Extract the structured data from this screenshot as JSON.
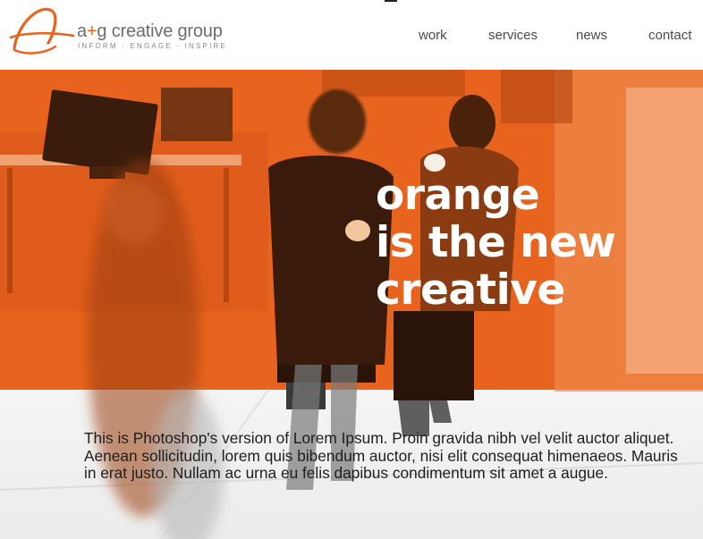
{
  "brand": {
    "name_prefix": "a",
    "name_plus": "+",
    "name_suffix": "g creative group",
    "tagline": "INFORM · ENGAGE · INSPIRE",
    "accent_color": "#e8641e"
  },
  "nav": {
    "items": [
      {
        "label": "work"
      },
      {
        "label": "services"
      },
      {
        "label": "news"
      },
      {
        "label": "contact"
      }
    ]
  },
  "hero": {
    "headline": [
      "orange",
      "is the new",
      "creative"
    ],
    "overlay_color": "#e8641e"
  },
  "body": {
    "text": "This is Photoshop's version  of Lorem Ipsum. Proin gravida nibh vel velit auctor aliquet. Aenean sollicitudin, lorem quis bibendum auctor, nisi elit consequat himenaeos. Mauris in erat justo. Nullam ac urna eu felis dapibus condimentum sit amet a augue."
  }
}
